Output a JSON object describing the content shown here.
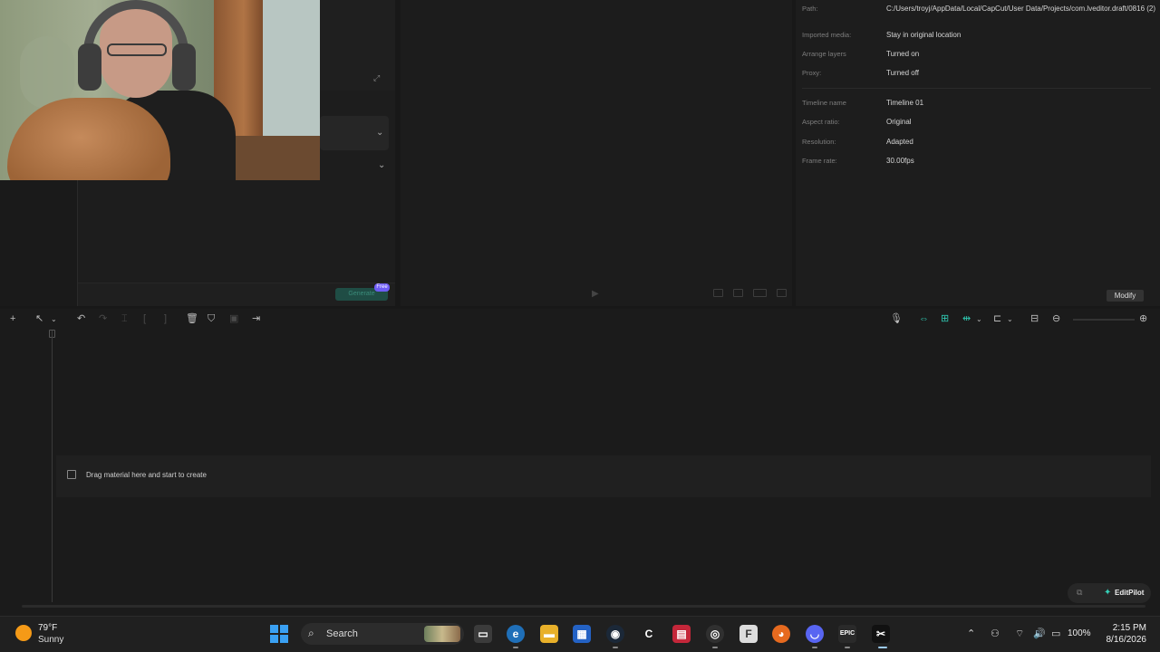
{
  "details": {
    "path_label": "Path:",
    "path_value": "C:/Users/troyj/AppData/Local/CapCut/User Data/Projects/com.lveditor.draft/0816 (2)",
    "imported_media_label": "Imported media:",
    "imported_media_value": "Stay in original location",
    "arrange_layers_label": "Arrange layers",
    "arrange_layers_value": "Turned on",
    "proxy_label": "Proxy:",
    "proxy_value": "Turned off",
    "timeline_name_label": "Timeline name",
    "timeline_name_value": "Timeline 01",
    "aspect_ratio_label": "Aspect ratio:",
    "aspect_ratio_value": "Original",
    "resolution_label": "Resolution:",
    "resolution_value": "Adapted",
    "frame_rate_label": "Frame rate:",
    "frame_rate_value": "30.00fps",
    "modify_label": "Modify"
  },
  "left_panel": {
    "generate_label": "Generate",
    "free_badge": "Free"
  },
  "timeline": {
    "drop_hint": "Drag material here and start to create",
    "editpilot_label": "EditPilot"
  },
  "taskbar": {
    "weather_temp": "79°F",
    "weather_condition": "Sunny",
    "search_label": "Search",
    "battery": "100%",
    "time": "2:15 PM",
    "date": "8/16/2026"
  },
  "colors": {
    "accent_teal": "#2fc7b0",
    "free_badge": "#6e5cf5",
    "windows_blue": "#3aa0f2"
  },
  "icons": [
    "plus-icon",
    "select-pointer-icon",
    "undo-icon",
    "redo-icon",
    "split-icon",
    "delete-icon",
    "marker-icon",
    "microphone-icon",
    "link-icon",
    "zoom-out-icon",
    "zoom-in-icon",
    "search-icon",
    "windows-icon"
  ]
}
